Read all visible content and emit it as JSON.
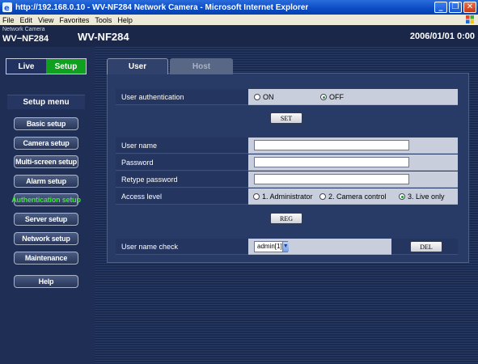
{
  "window": {
    "title": "http://192.168.0.10 - WV-NF284 Network Camera - Microsoft Internet Explorer",
    "minimize": "_",
    "restore": "❐",
    "close": "✕"
  },
  "menubar": {
    "items": [
      "File",
      "Edit",
      "View",
      "Favorites",
      "Tools",
      "Help"
    ]
  },
  "header": {
    "brand": "Network Camera",
    "model_small": "WV−NF284",
    "model": "WV-NF284",
    "datetime": "2006/01/01  0:00"
  },
  "sidebar": {
    "live": "Live",
    "setup": "Setup",
    "menu_title": "Setup menu",
    "items": [
      {
        "label": "Basic setup"
      },
      {
        "label": "Camera setup"
      },
      {
        "label": "Multi-screen setup"
      },
      {
        "label": "Alarm setup"
      },
      {
        "label": "Authentication setup"
      },
      {
        "label": "Server setup"
      },
      {
        "label": "Network setup"
      },
      {
        "label": "Maintenance"
      }
    ],
    "help": "Help"
  },
  "tabs": {
    "user": "User",
    "host": "Host"
  },
  "form": {
    "user_auth_label": "User authentication",
    "on_label": "ON",
    "off_label": "OFF",
    "set_button": "SET",
    "username_label": "User name",
    "username_value": "",
    "password_label": "Password",
    "password_value": "",
    "retype_label": "Retype password",
    "retype_value": "",
    "access_label": "Access level",
    "access_admin": "1. Administrator",
    "access_camera": "2. Camera control",
    "access_live": "3. Live only",
    "reg_button": "REG",
    "check_label": "User name check",
    "check_selected": "admin[1]",
    "del_button": "DEL"
  },
  "colors": {
    "titlebar": "#0a4bc4",
    "active_setup": "#0fa01f",
    "active_menu_text": "#3fe33a",
    "background": "#1d2d52"
  }
}
